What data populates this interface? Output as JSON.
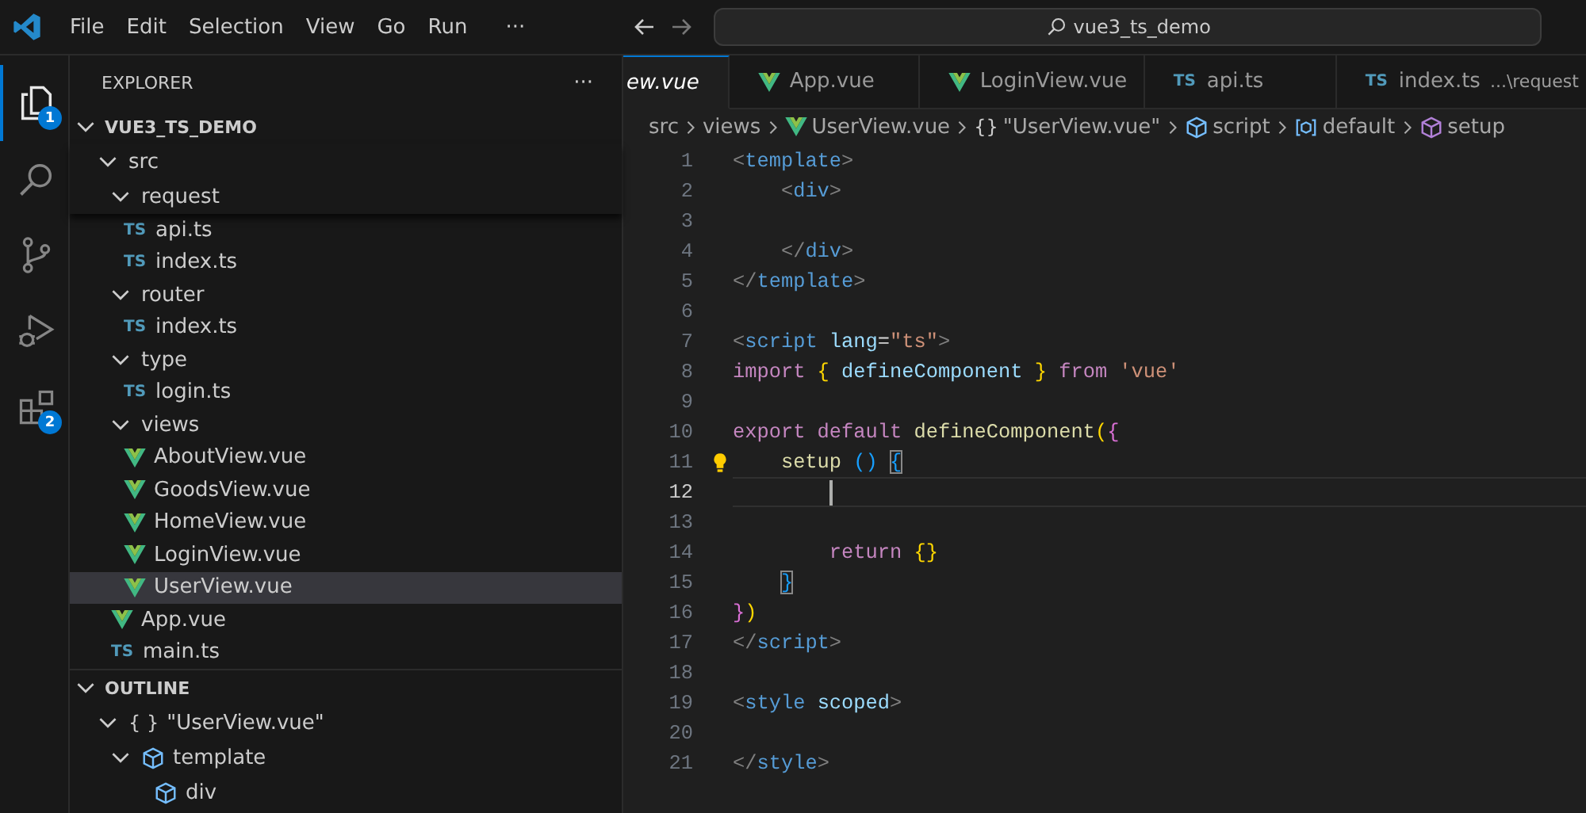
{
  "menu": [
    "File",
    "Edit",
    "Selection",
    "View",
    "Go",
    "Run"
  ],
  "more_menu": "···",
  "command_center": {
    "text": "vue3_ts_demo"
  },
  "activity_bar": [
    {
      "kind": "explorer",
      "selected": true,
      "badge": "1"
    },
    {
      "kind": "search",
      "selected": false
    },
    {
      "kind": "source-control",
      "selected": false
    },
    {
      "kind": "run-debug",
      "selected": false
    },
    {
      "kind": "extensions",
      "selected": false,
      "badge": "2"
    }
  ],
  "explorer": {
    "title": "EXPLORER",
    "more": "···",
    "root": {
      "label": "VUE3_TS_DEMO",
      "expanded": true
    },
    "tree": [
      {
        "label": "src",
        "kind": "folder",
        "expanded": true,
        "selected": false,
        "children": [
          {
            "label": "request",
            "kind": "folder",
            "expanded": true,
            "selected": false,
            "children": [
              {
                "label": "api.ts",
                "kind": "ts",
                "icon": "TS",
                "selected": false
              },
              {
                "label": "index.ts",
                "kind": "ts",
                "icon": "TS",
                "selected": false
              }
            ]
          },
          {
            "label": "router",
            "kind": "folder",
            "expanded": true,
            "selected": false,
            "children": [
              {
                "label": "index.ts",
                "kind": "ts",
                "icon": "TS",
                "selected": false
              }
            ]
          },
          {
            "label": "type",
            "kind": "folder",
            "expanded": true,
            "selected": false,
            "children": [
              {
                "label": "login.ts",
                "kind": "ts",
                "icon": "TS",
                "selected": false
              }
            ]
          },
          {
            "label": "views",
            "kind": "folder",
            "expanded": true,
            "selected": false,
            "children": [
              {
                "label": "AboutView.vue",
                "kind": "vue",
                "selected": false
              },
              {
                "label": "GoodsView.vue",
                "kind": "vue",
                "selected": false
              },
              {
                "label": "HomeView.vue",
                "kind": "vue",
                "selected": false
              },
              {
                "label": "LoginView.vue",
                "kind": "vue",
                "selected": false
              },
              {
                "label": "UserView.vue",
                "kind": "vue",
                "selected": true
              }
            ]
          },
          {
            "label": "App.vue",
            "kind": "vue",
            "selected": false
          },
          {
            "label": "main.ts",
            "kind": "ts",
            "icon": "TS",
            "selected": false
          }
        ]
      }
    ]
  },
  "outline": {
    "title": "OUTLINE",
    "expanded": true,
    "items": [
      {
        "label": "\"UserView.vue\"",
        "kind": "module",
        "symbol": "{ }",
        "expanded": true,
        "children": [
          {
            "label": "template",
            "kind": "element",
            "expanded": true,
            "children": [
              {
                "label": "div",
                "kind": "element"
              }
            ]
          }
        ]
      }
    ]
  },
  "tabs": [
    {
      "label": "ew.vue",
      "kind": "cut",
      "italic": true,
      "selected": true
    },
    {
      "label": "App.vue",
      "kind": "vue",
      "italic": false,
      "selected": false
    },
    {
      "label": "LoginView.vue",
      "kind": "vue",
      "italic": false,
      "selected": false
    },
    {
      "label": "api.ts",
      "kind": "ts",
      "icon": "TS",
      "italic": false,
      "selected": false
    },
    {
      "label": "index.ts",
      "kind": "ts",
      "icon": "TS",
      "description": "...\\request",
      "italic": false,
      "selected": false
    }
  ],
  "breadcrumbs": [
    {
      "label": "src",
      "kind": "plain"
    },
    {
      "label": "views",
      "kind": "plain"
    },
    {
      "label": "UserView.vue",
      "kind": "vue"
    },
    {
      "label": "\"UserView.vue\"",
      "kind": "module",
      "symbol": "{}"
    },
    {
      "label": "script",
      "kind": "element"
    },
    {
      "label": "default",
      "kind": "field"
    },
    {
      "label": "setup",
      "kind": "method"
    }
  ],
  "editor": {
    "lines": [
      {
        "number": "1",
        "current": false,
        "lightbulb": false,
        "tokens": [
          {
            "t": "<",
            "kind": "punct"
          },
          {
            "t": "template",
            "kind": "tag"
          },
          {
            "t": ">",
            "kind": "punct"
          }
        ]
      },
      {
        "number": "2",
        "current": false,
        "lightbulb": false,
        "tokens": [
          {
            "t": "    <",
            "kind": "punct"
          },
          {
            "t": "div",
            "kind": "tag"
          },
          {
            "t": ">",
            "kind": "punct"
          }
        ]
      },
      {
        "number": "3",
        "current": false,
        "lightbulb": false
      },
      {
        "number": "4",
        "current": false,
        "lightbulb": false,
        "tokens": [
          {
            "t": "    </",
            "kind": "punct"
          },
          {
            "t": "div",
            "kind": "tag"
          },
          {
            "t": ">",
            "kind": "punct"
          }
        ]
      },
      {
        "number": "5",
        "current": false,
        "lightbulb": false,
        "tokens": [
          {
            "t": "</",
            "kind": "punct"
          },
          {
            "t": "template",
            "kind": "tag"
          },
          {
            "t": ">",
            "kind": "punct"
          }
        ]
      },
      {
        "number": "6",
        "current": false,
        "lightbulb": false
      },
      {
        "number": "7",
        "current": false,
        "lightbulb": false,
        "tokens": [
          {
            "t": "<",
            "kind": "punct"
          },
          {
            "t": "script",
            "kind": "tag"
          },
          {
            "t": " lang",
            "kind": "attr"
          },
          {
            "t": "=",
            "kind": "plain"
          },
          {
            "t": "\"ts\"",
            "kind": "string"
          },
          {
            "t": ">",
            "kind": "punct"
          }
        ]
      },
      {
        "number": "8",
        "current": false,
        "lightbulb": false,
        "tokens": [
          {
            "t": "import",
            "kind": "keyword"
          },
          {
            "t": " {",
            "kind": "brace1"
          },
          {
            "t": " defineComponent ",
            "kind": "var"
          },
          {
            "t": "}",
            "kind": "brace1"
          },
          {
            "t": " from",
            "kind": "keyword"
          },
          {
            "t": " 'vue'",
            "kind": "string"
          }
        ]
      },
      {
        "number": "9",
        "current": false,
        "lightbulb": false
      },
      {
        "number": "10",
        "current": false,
        "lightbulb": false,
        "tokens": [
          {
            "t": "export default ",
            "kind": "keyword"
          },
          {
            "t": "defineComponent",
            "kind": "func"
          },
          {
            "t": "(",
            "kind": "brace1"
          },
          {
            "t": "{",
            "kind": "brace2"
          }
        ]
      },
      {
        "number": "11",
        "current": false,
        "lightbulb": true,
        "tokens": [
          {
            "t": "    setup",
            "kind": "func"
          },
          {
            "t": " () ",
            "kind": "brace3"
          },
          {
            "t": "{",
            "kind": "match"
          }
        ]
      },
      {
        "number": "12",
        "current": true,
        "lightbulb": false
      },
      {
        "number": "13",
        "current": false,
        "lightbulb": false
      },
      {
        "number": "14",
        "current": false,
        "lightbulb": false,
        "tokens": [
          {
            "t": "        return",
            "kind": "keyword"
          },
          {
            "t": " {}",
            "kind": "brace1"
          }
        ]
      },
      {
        "number": "15",
        "current": false,
        "lightbulb": false,
        "tokens": [
          {
            "t": "    }",
            "kind": "match"
          }
        ]
      },
      {
        "number": "16",
        "current": false,
        "lightbulb": false,
        "tokens": [
          {
            "t": "}",
            "kind": "brace2"
          },
          {
            "t": ")",
            "kind": "brace1"
          }
        ]
      },
      {
        "number": "17",
        "current": false,
        "lightbulb": false,
        "tokens": [
          {
            "t": "</",
            "kind": "punct"
          },
          {
            "t": "script",
            "kind": "tag"
          },
          {
            "t": ">",
            "kind": "punct"
          }
        ]
      },
      {
        "number": "18",
        "current": false,
        "lightbulb": false
      },
      {
        "number": "19",
        "current": false,
        "lightbulb": false,
        "tokens": [
          {
            "t": "<",
            "kind": "punct"
          },
          {
            "t": "style",
            "kind": "tag"
          },
          {
            "t": " scoped",
            "kind": "attr"
          },
          {
            "t": ">",
            "kind": "punct"
          }
        ]
      },
      {
        "number": "20",
        "current": false,
        "lightbulb": false
      },
      {
        "number": "21",
        "current": false,
        "lightbulb": false,
        "tokens": [
          {
            "t": "</",
            "kind": "punct"
          },
          {
            "t": "style",
            "kind": "tag"
          },
          {
            "t": ">",
            "kind": "punct"
          }
        ]
      }
    ]
  }
}
